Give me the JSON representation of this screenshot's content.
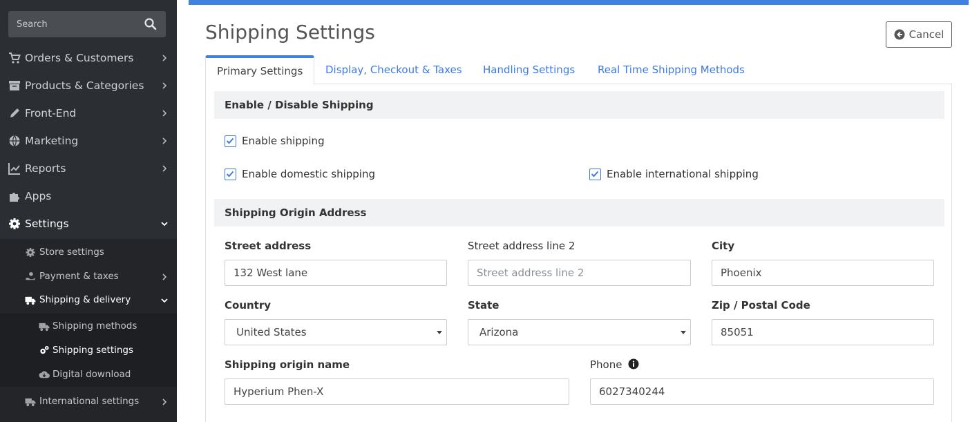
{
  "sidebar": {
    "search_placeholder": "Search",
    "items": [
      {
        "label": "Orders & Customers",
        "icon": "cart-icon"
      },
      {
        "label": "Products & Categories",
        "icon": "archive-icon"
      },
      {
        "label": "Front-End",
        "icon": "pencil-icon"
      },
      {
        "label": "Marketing",
        "icon": "globe-icon"
      },
      {
        "label": "Reports",
        "icon": "chart-icon"
      },
      {
        "label": "Apps",
        "icon": "puzzle-icon"
      },
      {
        "label": "Settings",
        "icon": "gear-icon"
      }
    ],
    "settings_sub": [
      {
        "label": "Store settings",
        "icon": "gear-icon"
      },
      {
        "label": "Payment & taxes",
        "icon": "hand-coin-icon"
      },
      {
        "label": "Shipping & delivery",
        "icon": "truck-icon"
      },
      {
        "label": "International settings",
        "icon": "truck-icon"
      }
    ],
    "shipping_sub": [
      {
        "label": "Shipping methods",
        "icon": "truck-icon"
      },
      {
        "label": "Shipping settings",
        "icon": "gears-icon"
      },
      {
        "label": "Digital download",
        "icon": "cloud-download-icon"
      }
    ]
  },
  "page": {
    "title": "Shipping Settings",
    "cancel_label": "Cancel",
    "accent": "#3d82e0"
  },
  "tabs": [
    {
      "label": "Primary Settings",
      "active": true
    },
    {
      "label": "Display, Checkout & Taxes",
      "active": false
    },
    {
      "label": "Handling Settings",
      "active": false
    },
    {
      "label": "Real Time Shipping Methods",
      "active": false
    }
  ],
  "sections": {
    "enable_title": "Enable / Disable Shipping",
    "enable_shipping": "Enable shipping",
    "enable_domestic": "Enable domestic shipping",
    "enable_international": "Enable international shipping",
    "origin_title": "Shipping Origin Address"
  },
  "form": {
    "street_label": "Street address",
    "street_value": "132 West lane",
    "street2_label": "Street address line 2",
    "street2_placeholder": "Street address line 2",
    "city_label": "City",
    "city_value": "Phoenix",
    "country_label": "Country",
    "country_value": "United States",
    "state_label": "State",
    "state_value": "Arizona",
    "zip_label": "Zip / Postal Code",
    "zip_value": "85051",
    "origin_name_label": "Shipping origin name",
    "origin_name_value": "Hyperium Phen-X",
    "phone_label": "Phone",
    "phone_value": "6027340244"
  }
}
